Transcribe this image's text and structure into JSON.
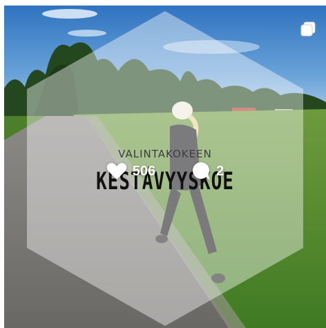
{
  "post": {
    "poster_line1": "VALINTAKOKEEN",
    "poster_line2": "KESTÄVYYSKOE",
    "likes": "506",
    "comments": "2"
  },
  "icons": {
    "multi": "multiple-images-icon",
    "like": "heart-icon",
    "comment": "speech-bubble-icon"
  },
  "colors": {
    "overlay_text": "#ffffff",
    "hexagon_fill": "rgba(255,255,255,0.45)"
  }
}
